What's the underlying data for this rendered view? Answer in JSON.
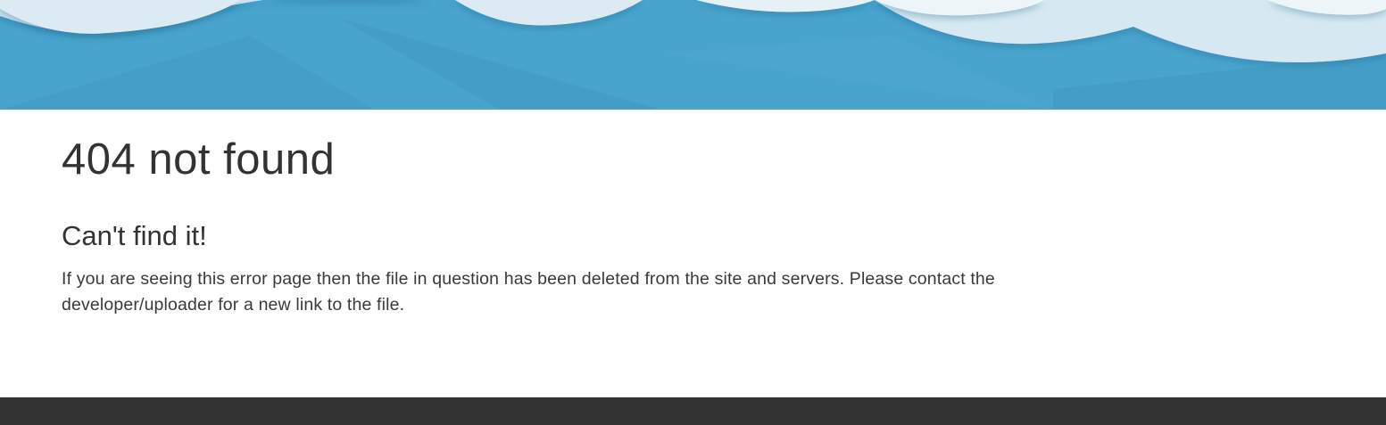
{
  "main": {
    "title": "404 not found",
    "heading": "Can't find it!",
    "message": "If you are seeing this error page then the file in question has been deleted from the site and servers. Please contact the developer/uploader for a new link to the file."
  },
  "colors": {
    "hero_blue": "#48a3cd",
    "cloud": "#dcebf3",
    "text": "#333333",
    "footer": "#333333"
  }
}
